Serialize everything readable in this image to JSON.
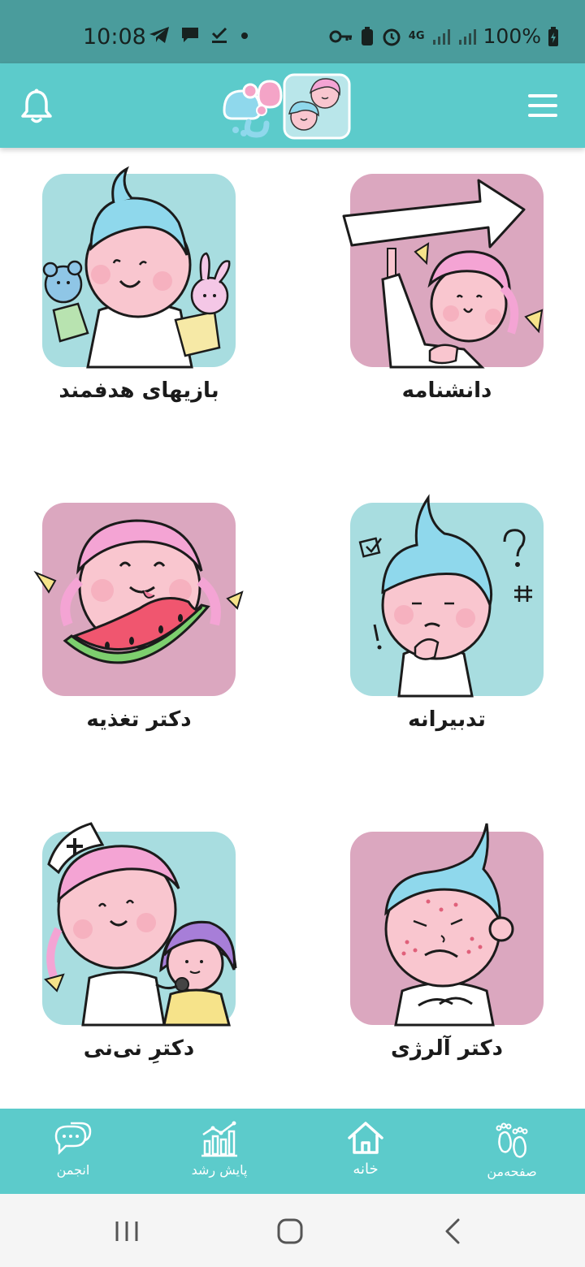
{
  "status_bar": {
    "time": "10:08",
    "network": "4G",
    "battery": "100%",
    "icons": [
      "telegram-icon",
      "chat-icon",
      "download-check-icon",
      "dot-icon",
      "key-icon",
      "battery-saver-icon",
      "alarm-icon",
      "network-4g-icon",
      "signal-icon",
      "signal-icon",
      "battery-icon"
    ]
  },
  "header": {
    "logo_alt": "مامی و بابی",
    "icons": [
      "bell-icon",
      "hamburger-menu-icon"
    ]
  },
  "cards": [
    {
      "label": "دانشنامه",
      "bg": "#dba7bf",
      "icon": "girl-holding-arrow-sign-icon"
    },
    {
      "label": "بازیهای هدفمند",
      "bg": "#a8dde0",
      "icon": "boy-with-puppets-icon"
    },
    {
      "label": "تدبیرانه",
      "bg": "#a8dde0",
      "icon": "boy-thinking-icon"
    },
    {
      "label": "دکتر تغذیه",
      "bg": "#dba7bf",
      "icon": "girl-eating-watermelon-icon"
    },
    {
      "label": "دکتر آلرژی",
      "bg": "#dba7bf",
      "icon": "boy-with-rash-icon"
    },
    {
      "label": "دکترِ نی‌نی",
      "bg": "#a8dde0",
      "icon": "nurse-with-child-icon"
    }
  ],
  "bottom_nav": [
    {
      "label": "صفحه‌من",
      "icon": "footprints-icon"
    },
    {
      "label": "خانه",
      "icon": "home-icon"
    },
    {
      "label": "پایش رشد",
      "icon": "growth-chart-icon"
    },
    {
      "label": "انجمن",
      "icon": "forum-chat-icon"
    }
  ],
  "colors": {
    "status_bar": "#4a9c9c",
    "header": "#5ccbcb",
    "pink_card": "#dba7bf",
    "blue_card": "#a8dde0"
  }
}
